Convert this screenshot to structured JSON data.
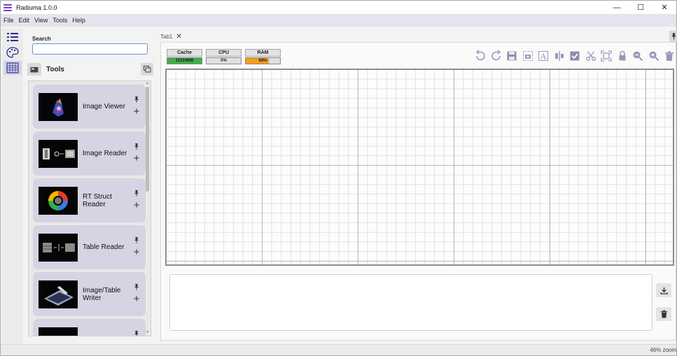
{
  "app": {
    "title": "Radiuma 1.0.0"
  },
  "window_controls": {
    "minimize": "—",
    "maximize": "☐",
    "close": "✕"
  },
  "menu": [
    "File",
    "Edit",
    "View",
    "Tools",
    "Help"
  ],
  "rail": {
    "icons": [
      "list-icon",
      "palette-icon",
      "grid-icon"
    ]
  },
  "tools_panel": {
    "search_label": "Search",
    "search_value": "",
    "header": "Tools",
    "items": [
      {
        "name": "Image Viewer"
      },
      {
        "name": "Image Reader"
      },
      {
        "name": "RT Struct Reader"
      },
      {
        "name": "Table Reader"
      },
      {
        "name": "Image/Table Writer"
      }
    ]
  },
  "tab": {
    "label": "Tab1",
    "close": "✕"
  },
  "meters": {
    "cache": {
      "label": "Cache",
      "value": "11024MB",
      "fill": 1.0,
      "color": "#3fae49"
    },
    "cpu": {
      "label": "CPU",
      "value": "0%",
      "fill": 0.0,
      "color": "#3fae49"
    },
    "ram": {
      "label": "RAM",
      "value": "68%",
      "fill": 0.68,
      "color": "#f39c1f"
    }
  },
  "toolbar": [
    "undo-icon",
    "redo-icon",
    "save-icon",
    "camera-icon",
    "text-icon",
    "align-icon",
    "check-icon",
    "scissors-icon",
    "fit-icon",
    "lock-icon",
    "zoom-out-icon",
    "zoom-in-icon",
    "trash-icon"
  ],
  "log": {
    "download": "download-icon",
    "clear": "trash-icon"
  },
  "status": {
    "zoom": "46% zoom"
  }
}
